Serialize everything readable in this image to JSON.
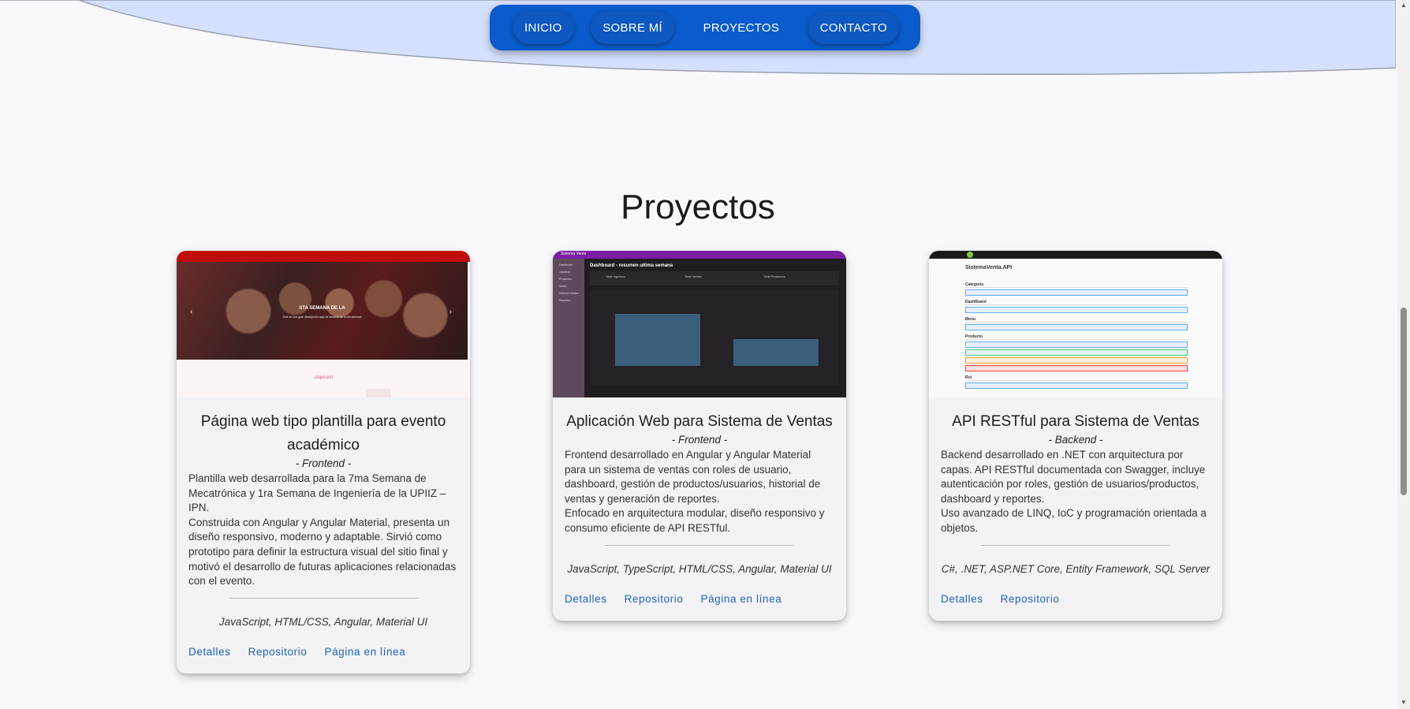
{
  "nav": {
    "items": [
      {
        "label": "INICIO"
      },
      {
        "label": "SOBRE MÍ"
      },
      {
        "label": "PROYECTOS"
      },
      {
        "label": "CONTACTO"
      }
    ]
  },
  "section": {
    "title": "Proyectos"
  },
  "cards": [
    {
      "title": "Página web tipo plantilla para evento académico",
      "type": "- Frontend -",
      "desc": [
        "Plantilla web desarrollada para la 7ma Semana de Mecatrónica y 1ra Semana de Ingeniería de la UPIIZ – IPN.",
        "Construida con Angular y Angular Material, presenta un diseño responsivo, moderno y adaptable. Sirvió como prototipo para definir la estructura visual del sitio final y motivó el desarrollo de futuras aplicaciones relacionadas con el evento."
      ],
      "tech": "JavaScript, HTML/CSS, Angular, Material UI",
      "actions": [
        "Detalles",
        "Repositorio",
        "Página en línea"
      ],
      "preview": {
        "banner_title": "STA SEMANA DE LA",
        "banner_sub": "Este es una gran descripción aquí de semana de la mecatrónica",
        "footer_text": "¡Aquí es!"
      }
    },
    {
      "title": "Aplicación Web para Sistema de Ventas",
      "type": "- Frontend -",
      "desc": [
        "Frontend desarrollado en Angular y Angular Material para un sistema de ventas con roles de usuario, dashboard, gestión de productos/usuarios, historial de ventas y generación de reportes.",
        "Enfocado en arquitectura modular, diseño responsivo y consumo eficiente de API RESTful."
      ],
      "tech": "JavaScript, TypeScript, HTML/CSS, Angular, Material UI",
      "actions": [
        "Detalles",
        "Repositorio",
        "Página en línea"
      ],
      "preview": {
        "app_name": "Sistema Venta",
        "dashboard_title": "Dashboard - resumen ultima semana",
        "stat1": "Total Ingresos",
        "stat2": "Total Ventas",
        "stat3": "Total Productos",
        "menu": [
          "Dashboard",
          "Usuarios",
          "Productos",
          "Venta",
          "Historial Ventas",
          "Reportes"
        ]
      }
    },
    {
      "title": "API RESTful para Sistema de Ventas",
      "type": "- Backend -",
      "desc": [
        "Backend desarrollado en .NET con arquitectura por capas. API RESTful documentada con Swagger, incluye autenticación por roles, gestión de usuarios/productos, dashboard y reportes.",
        "Uso avanzado de LINQ, IoC y programación orientada a objetos."
      ],
      "tech": "C#, .NET, ASP.NET Core, Entity Framework, SQL Server",
      "actions": [
        "Detalles",
        "Repositorio"
      ],
      "preview": {
        "api_title": "SistemaVenta.API",
        "groups": [
          "Categoria",
          "DashBoard",
          "Menu",
          "Producto",
          "Rol"
        ]
      }
    }
  ],
  "colors": {
    "nav": "#0a5ccc",
    "hero": "#d5e0fd",
    "link": "#1a65b8"
  }
}
